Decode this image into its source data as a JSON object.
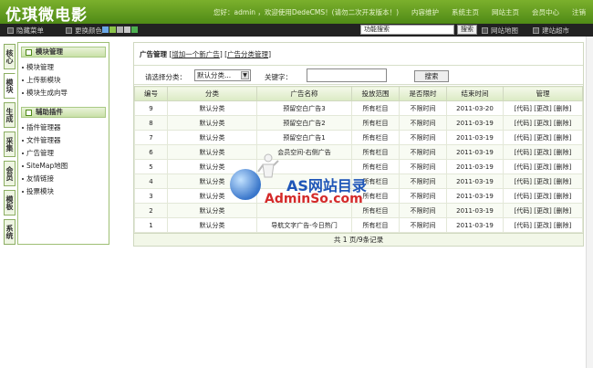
{
  "header": {
    "logo": "优琪微电影",
    "welcome": "您好：admin ，欢迎使用DedeCMS！(请勿二次开发版本！)",
    "links": [
      "内容维护",
      "系统主页",
      "网站主页",
      "会员中心",
      "注销"
    ]
  },
  "toolbar": {
    "hide_menu": "隐藏菜单",
    "change_color": "更换颜色",
    "swatches": [
      "#6aa7e6",
      "#8bc34a",
      "#b2b2b2",
      "#c8c8c8",
      "#4caf50"
    ],
    "search_placeholder": "功能搜索",
    "search_btn": "搜索",
    "sitemap": "网站地图",
    "shortcut": "建站超市"
  },
  "lefttabs": [
    "核心",
    "模块",
    "生成",
    "采集",
    "会员",
    "模板",
    "系统"
  ],
  "sidebar": {
    "groups": [
      {
        "title": "模块管理",
        "items": [
          "模块管理",
          "上传新模块",
          "模块生成向导"
        ]
      },
      {
        "title": "辅助插件",
        "items": [
          "插件管理器",
          "文件管理器",
          "广告管理",
          "SiteMap地图",
          "友情链接",
          "投票模块"
        ]
      }
    ]
  },
  "main": {
    "crumbs_title": "广告管理",
    "crumbs_links": [
      "增加一个新广告",
      "广告分类管理"
    ],
    "filter": {
      "cat_label": "请选择分类：",
      "cat_value": "默认分类...",
      "kw_label": "关键字：",
      "search_btn": "搜索"
    },
    "columns": [
      "编号",
      "分类",
      "广告名称",
      "投放范围",
      "是否限时",
      "结束时间",
      "管理"
    ],
    "rows": [
      [
        "9",
        "默认分类",
        "预留空白广告3",
        "所有栏目",
        "不限时间",
        "2011-03-20",
        "[代码] [更改] [删除]"
      ],
      [
        "8",
        "默认分类",
        "预留空白广告2",
        "所有栏目",
        "不限时间",
        "2011-03-19",
        "[代码] [更改] [删除]"
      ],
      [
        "7",
        "默认分类",
        "预留空白广告1",
        "所有栏目",
        "不限时间",
        "2011-03-19",
        "[代码] [更改] [删除]"
      ],
      [
        "6",
        "默认分类",
        "会员空间-右侧广告",
        "所有栏目",
        "不限时间",
        "2011-03-19",
        "[代码] [更改] [删除]"
      ],
      [
        "5",
        "默认分类",
        "",
        "所有栏目",
        "不限时间",
        "2011-03-19",
        "[代码] [更改] [删除]"
      ],
      [
        "4",
        "默认分类",
        "",
        "所有栏目",
        "不限时间",
        "2011-03-19",
        "[代码] [更改] [删除]"
      ],
      [
        "3",
        "默认分类",
        "",
        "所有栏目",
        "不限时间",
        "2011-03-19",
        "[代码] [更改] [删除]"
      ],
      [
        "2",
        "默认分类",
        "",
        "所有栏目",
        "不限时间",
        "2011-03-19",
        "[代码] [更改] [删除]"
      ],
      [
        "1",
        "默认分类",
        "导航文字广告-今日热门",
        "所有栏目",
        "不限时间",
        "2011-03-19",
        "[代码] [更改] [删除]"
      ]
    ],
    "pager": "共 1 页/9条记录"
  },
  "watermark": {
    "title": "AS网站目录",
    "sub": "AdminSo.com"
  }
}
